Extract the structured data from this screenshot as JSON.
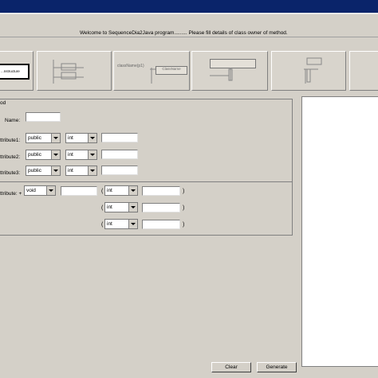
{
  "header": {
    "welcome": "Welcome to SequenceDia2Java program......... Please fill details of class owner of method."
  },
  "toolbar": {
    "items": [
      {
        "label": "...nstructure"
      },
      {
        "label": "[ ... ]"
      },
      {
        "label": "className(p1)",
        "sub": "ClassName"
      },
      {
        "label": "...",
        "sub": "..."
      },
      {
        "label": "..."
      },
      {
        "label": ""
      }
    ]
  },
  "form": {
    "section_label": "od",
    "name_label": "Name:",
    "attributes": [
      {
        "label": "ttribute1:",
        "access": "public",
        "type": "int",
        "value": ""
      },
      {
        "label": "ttribute2:",
        "access": "public",
        "type": "int",
        "value": ""
      },
      {
        "label": "ttribute3:",
        "access": "public",
        "type": "int",
        "value": ""
      }
    ],
    "method_label": "ttribute: +",
    "method_return": "void",
    "params": [
      {
        "open": "(",
        "type": "int",
        "close": ")"
      },
      {
        "open": "(",
        "type": "int",
        "close": ")"
      },
      {
        "open": "(",
        "type": "int",
        "close": ")"
      }
    ]
  },
  "buttons": {
    "clear": "Clear",
    "generate": "Generate"
  }
}
